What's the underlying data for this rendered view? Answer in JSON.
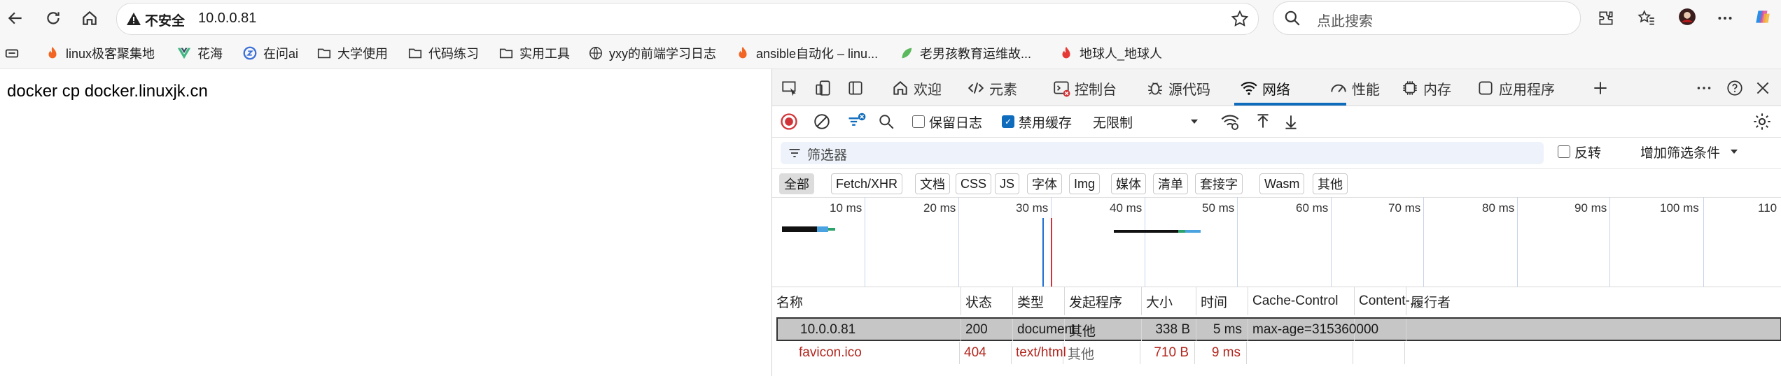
{
  "toolbar": {
    "address_warning": "不安全",
    "url": "10.0.0.81",
    "search_placeholder": "点此搜索"
  },
  "bookmarks": [
    {
      "label": "linux极客聚集地",
      "icon": "flame-icon"
    },
    {
      "label": "花海",
      "icon": "vue-icon"
    },
    {
      "label": "在问ai",
      "icon": "ai-icon"
    },
    {
      "label": "大学使用",
      "icon": "folder-icon"
    },
    {
      "label": "代码练习",
      "icon": "folder-icon"
    },
    {
      "label": "实用工具",
      "icon": "folder-icon"
    },
    {
      "label": "yxy的前端学习日志",
      "icon": "globe-icon"
    },
    {
      "label": "ansible自动化 – linu...",
      "icon": "flame-icon"
    },
    {
      "label": "老男孩教育运维故...",
      "icon": "leaf-icon"
    },
    {
      "label": "地球人_地球人",
      "icon": "fire-icon"
    }
  ],
  "page": {
    "text": "docker cp docker.linuxjk.cn"
  },
  "devtools": {
    "tabs": [
      "欢迎",
      "元素",
      "控制台",
      "源代码",
      "网络",
      "性能",
      "内存",
      "应用程序"
    ],
    "active_tab": "网络",
    "network_toolbar": {
      "preserve_log": "保留日志",
      "disable_cache": "禁用缓存",
      "throttle": "无限制"
    },
    "filter": {
      "placeholder": "筛选器",
      "invert": "反转",
      "more_filters": "增加筛选条件"
    },
    "type_filters": [
      "全部",
      "Fetch/XHR",
      "文档",
      "CSS",
      "JS",
      "字体",
      "Img",
      "媒体",
      "清单",
      "套接字",
      "Wasm",
      "其他"
    ],
    "timeline_ticks": [
      "10 ms",
      "20 ms",
      "30 ms",
      "40 ms",
      "50 ms",
      "60 ms",
      "70 ms",
      "80 ms",
      "90 ms",
      "100 ms",
      "110"
    ],
    "columns": [
      "名称",
      "状态",
      "类型",
      "发起程序",
      "大小",
      "时间",
      "Cache-Control",
      "Content-...",
      "履行者"
    ],
    "rows": [
      {
        "name": "10.0.0.81",
        "status": "200",
        "type": "document",
        "initiator": "其他",
        "size": "338 B",
        "time": "5 ms",
        "cache_control": "max-age=315360000",
        "content": "",
        "fulfilled": ""
      },
      {
        "name": "favicon.ico",
        "status": "404",
        "type": "text/html",
        "initiator": "其他",
        "size": "710 B",
        "time": "9 ms",
        "cache_control": "",
        "content": "",
        "fulfilled": ""
      }
    ],
    "colors": {
      "error": "#b3261e",
      "accent": "#0f6cbd",
      "record": "#d13438"
    }
  }
}
